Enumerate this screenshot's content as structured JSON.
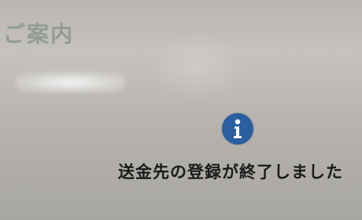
{
  "header": {
    "title": "ご案内"
  },
  "dialog": {
    "icon": "info-icon",
    "message": "送金先の登録が終了しました"
  },
  "colors": {
    "title_text": "#8f9a8f",
    "icon_background": "#2a5fa0",
    "message_text": "#1a1a1a"
  }
}
